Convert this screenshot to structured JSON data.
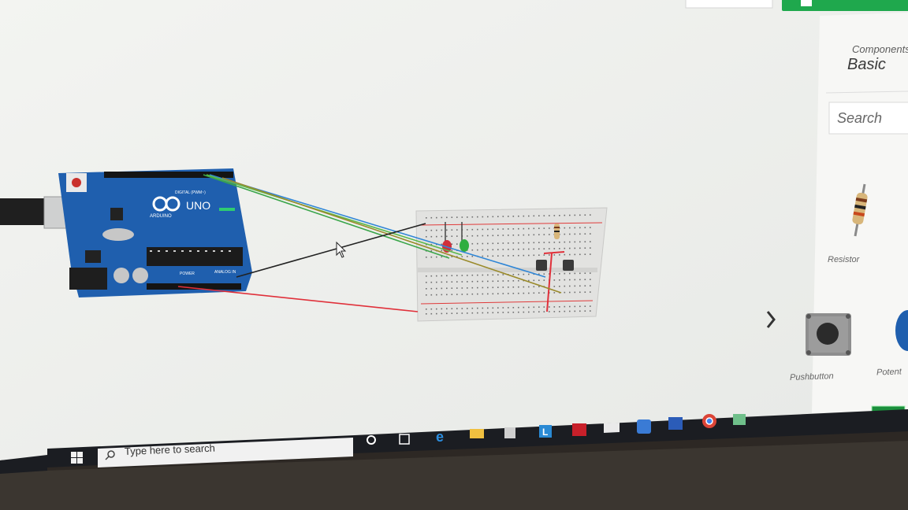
{
  "panel": {
    "components_label": "Components",
    "category_value": "Basic",
    "search_placeholder": "Search"
  },
  "components": [
    {
      "label": "Resistor"
    },
    {
      "label": "Pushbutton"
    },
    {
      "label": "Potent"
    }
  ],
  "board": {
    "brand": "ARDUINO",
    "model": "UNO",
    "digital_label": "DIGITAL (PWM~)",
    "power_label": "POWER",
    "analog_label": "ANALOG IN"
  },
  "taskbar": {
    "search_placeholder": "Type here to search"
  },
  "colors": {
    "accent_green": "#1fa84d",
    "board_blue": "#1f5fae",
    "wire_red": "#e0303a",
    "wire_black": "#222222",
    "wire_blue": "#2f86d6",
    "wire_green": "#3aa64a",
    "wire_olive": "#9a8a2a"
  }
}
